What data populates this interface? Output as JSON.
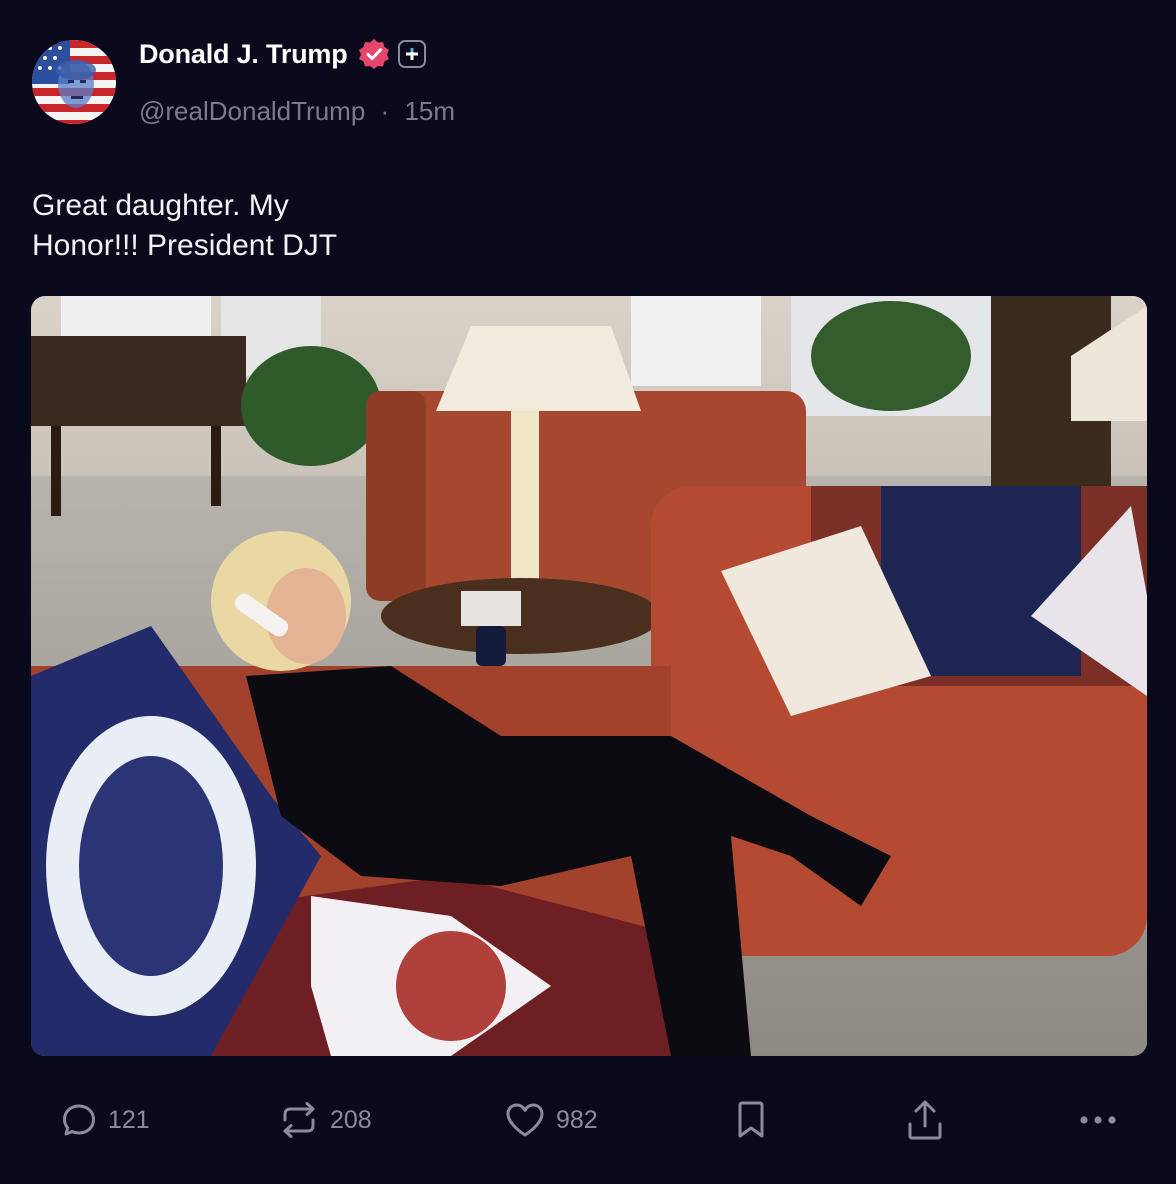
{
  "post": {
    "author_name": "Donald J. Trump",
    "handle": "@realDonaldTrump",
    "separator": "·",
    "time_ago": "15m",
    "text_lines": [
      "Great daughter. My",
      "Honor!!! President DJT"
    ],
    "badges": [
      "verified-badge-icon",
      "plus-badge-icon"
    ],
    "colors": {
      "background": "#0a0a1c",
      "verified": "#e5476a",
      "muted": "#8b8b9c"
    }
  },
  "actions": {
    "reply_count": "121",
    "repost_count": "208",
    "like_count": "982",
    "icons": [
      "reply-icon",
      "repost-icon",
      "heart-icon",
      "bookmark-icon",
      "share-icon",
      "more-icon"
    ]
  }
}
